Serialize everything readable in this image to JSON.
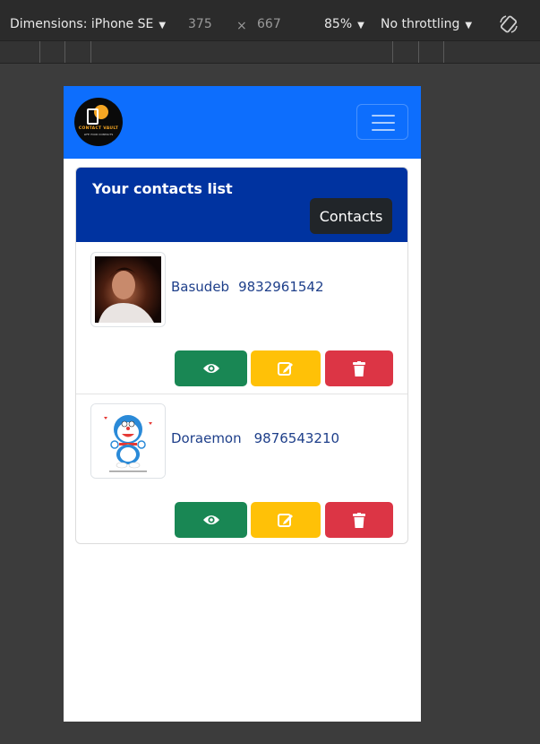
{
  "devtools": {
    "dimensions_label": "Dimensions: iPhone SE",
    "width": "375",
    "times": "×",
    "height": "667",
    "zoom": "85%",
    "throttling": "No throttling",
    "rotate_icon": "rotate-icon"
  },
  "app": {
    "logo_text": "CONTACT VAULT",
    "logo_subtext": "LIFE YOUR CONTACTS",
    "card_title": "Your contacts list",
    "contacts_button": "Contacts",
    "contacts": [
      {
        "name": "Basudeb",
        "phone": "9832961542",
        "avatar": "person-photo"
      },
      {
        "name": "Doraemon",
        "phone": "9876543210",
        "avatar": "doraemon-image"
      }
    ],
    "actions": {
      "view_icon": "eye-icon",
      "edit_icon": "edit-icon",
      "delete_icon": "trash-icon"
    }
  },
  "colors": {
    "navbar": "#0d6efd",
    "card_header": "#0033a0",
    "view": "#198754",
    "edit": "#ffc107",
    "delete": "#dc3545"
  }
}
